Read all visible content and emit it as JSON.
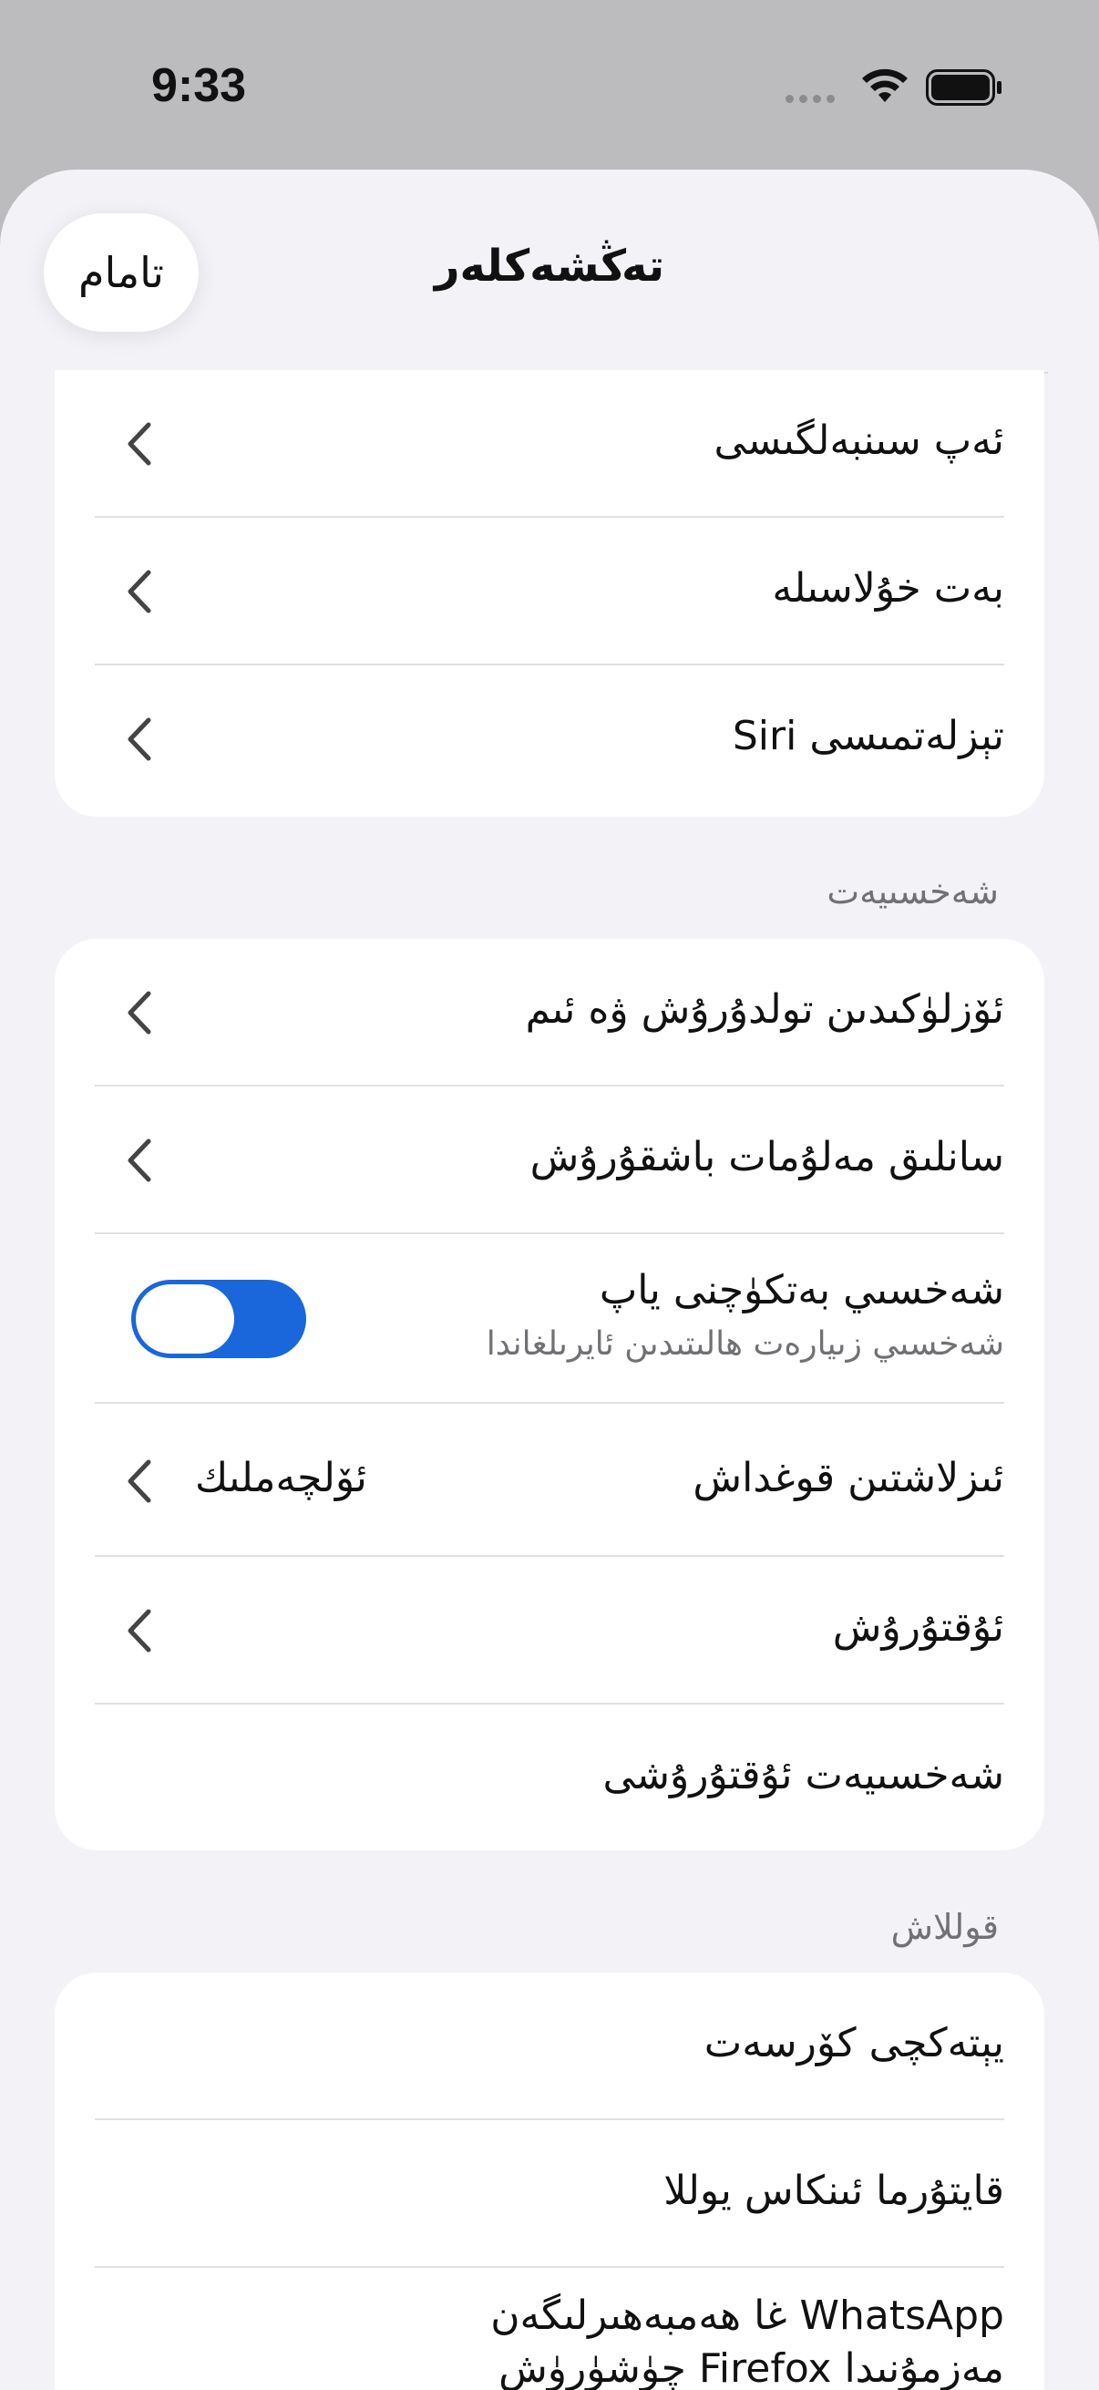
{
  "status_bar": {
    "time": "9:33"
  },
  "nav": {
    "title": "تەڭشەكلەر",
    "done_label": "تامام"
  },
  "group1": {
    "items": [
      {
        "label": "ئەپ سىنبەلگىسى"
      },
      {
        "label": "بەت خۇلاسىلە"
      },
      {
        "label": "تېزلەتمىسى Siri"
      }
    ]
  },
  "privacy": {
    "header": "شەخسىيەت",
    "items": [
      {
        "label": "ئۆزلۈكىدىن تولدۇرۇش ۋە ئىم"
      },
      {
        "label": "سانلىق مەلۇمات باشقۇرۇش"
      },
      {
        "label": "شەخسىي بەتكۈچنى ياپ",
        "sublabel": "شەخسىي زىيارەت ھالىتىدىن ئايرىلغاندا",
        "toggle_on": true
      },
      {
        "label": "ئىزلاشتىن قوغداش",
        "value": "ئۆلچەملىك"
      },
      {
        "label": "ئۇقتۇرۇش"
      },
      {
        "label": "شەخسىيەت ئۇقتۇرۇشى"
      }
    ]
  },
  "support": {
    "header": "قوللاش",
    "items": [
      {
        "label": "يېتەكچى كۆرسەت"
      },
      {
        "label": "قايتۇرما ئىنكاس يوللا"
      },
      {
        "label": "WhatsApp غا ھەمبەھىرلىگەن مەزمۇنىدا Firefox چۈشۈرۈش"
      }
    ]
  }
}
